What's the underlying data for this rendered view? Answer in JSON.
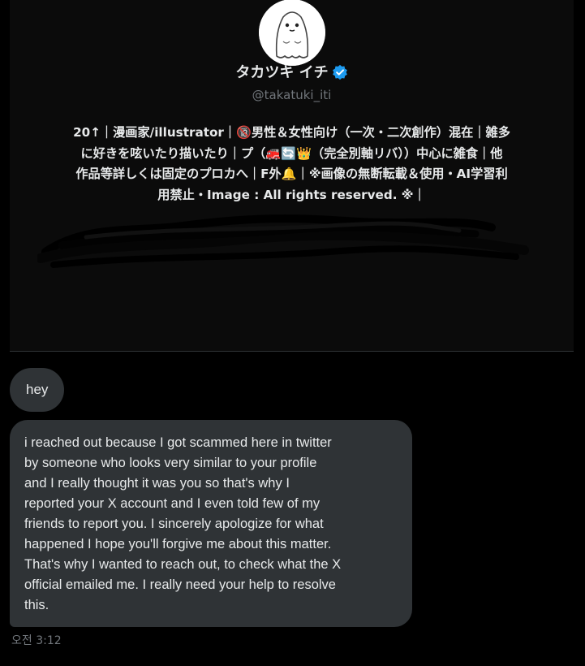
{
  "profile": {
    "display_name": "タカツキ イチ",
    "handle": "@takatuki_iti",
    "verified_icon": "verified-badge-icon",
    "bio_lines": [
      "20↑｜漫画家/illustrator｜🔞男性＆女性向け（一次・二次創作）混在｜雑多",
      "に好きを呟いたり描いたり｜プ（🚒🔄👑（完全別軸リバ））中心に雑食｜他",
      "作品等詳しくは固定のプロカへ｜F外🔔｜※画像の無断転載＆使用・AI学習利",
      "用禁止・Image : All rights reserved. ※｜"
    ],
    "colors": {
      "background": "#0b0b0b",
      "text": "#e7e9ea",
      "muted": "#71767b",
      "verified": "#1d9bf0"
    }
  },
  "messages": [
    {
      "text": "hey"
    },
    {
      "text": "i  reached out because I got scammed here in twitter\nby someone who looks very similar to your profile\nand I really thought it was you so that's why I\nreported your X account and I even told few of my\nfriends to report you. I sincerely apologize for what\nhappened I hope you'll forgive me about this matter.\nThat's why I wanted to reach out, to check what the X\nofficial emailed me. I really need your help to resolve\nthis."
    }
  ],
  "timestamp": "오전 3:12",
  "colors": {
    "page_background": "#000000",
    "bubble_background": "#2f3336"
  }
}
